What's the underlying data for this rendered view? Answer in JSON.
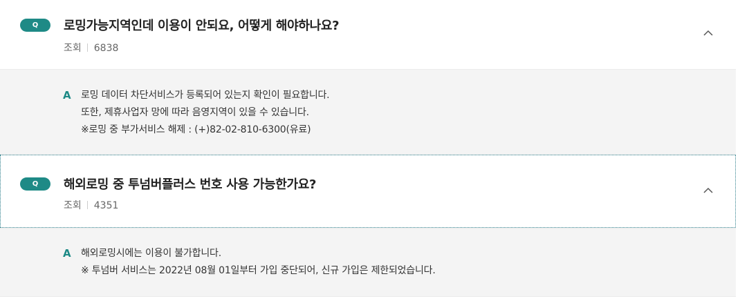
{
  "faq": [
    {
      "badge": "Q",
      "question": "로밍가능지역인데 이용이 안되요, 어떻게 해야하나요?",
      "views_label": "조회",
      "views": "6838",
      "answer_badge": "A",
      "answer_lines": [
        "로밍 데이터 차단서비스가 등록되어 있는지 확인이 필요합니다.",
        "또한, 제휴사업자 망에 따라 음영지역이 있을 수 있습니다.",
        "※로밍 중 부가서비스 해제 : (+)82-02-810-6300(유료)"
      ],
      "expanded_icon": "chevron-up-icon"
    },
    {
      "badge": "Q",
      "question": "해외로밍 중 투넘버플러스 번호 사용 가능한가요?",
      "views_label": "조회",
      "views": "4351",
      "answer_badge": "A",
      "answer_lines": [
        "해외로밍시에는 이용이 불가합니다.",
        "※ 투넘버 서비스는 2022년 08월 01일부터 가입 중단되어, 신규 가입은 제한되었습니다."
      ],
      "expanded_icon": "chevron-up-icon"
    }
  ],
  "colors": {
    "accent": "#1e8a86",
    "answer_bg": "#f4f4f4",
    "focus_outline": "#2a7d8a"
  }
}
